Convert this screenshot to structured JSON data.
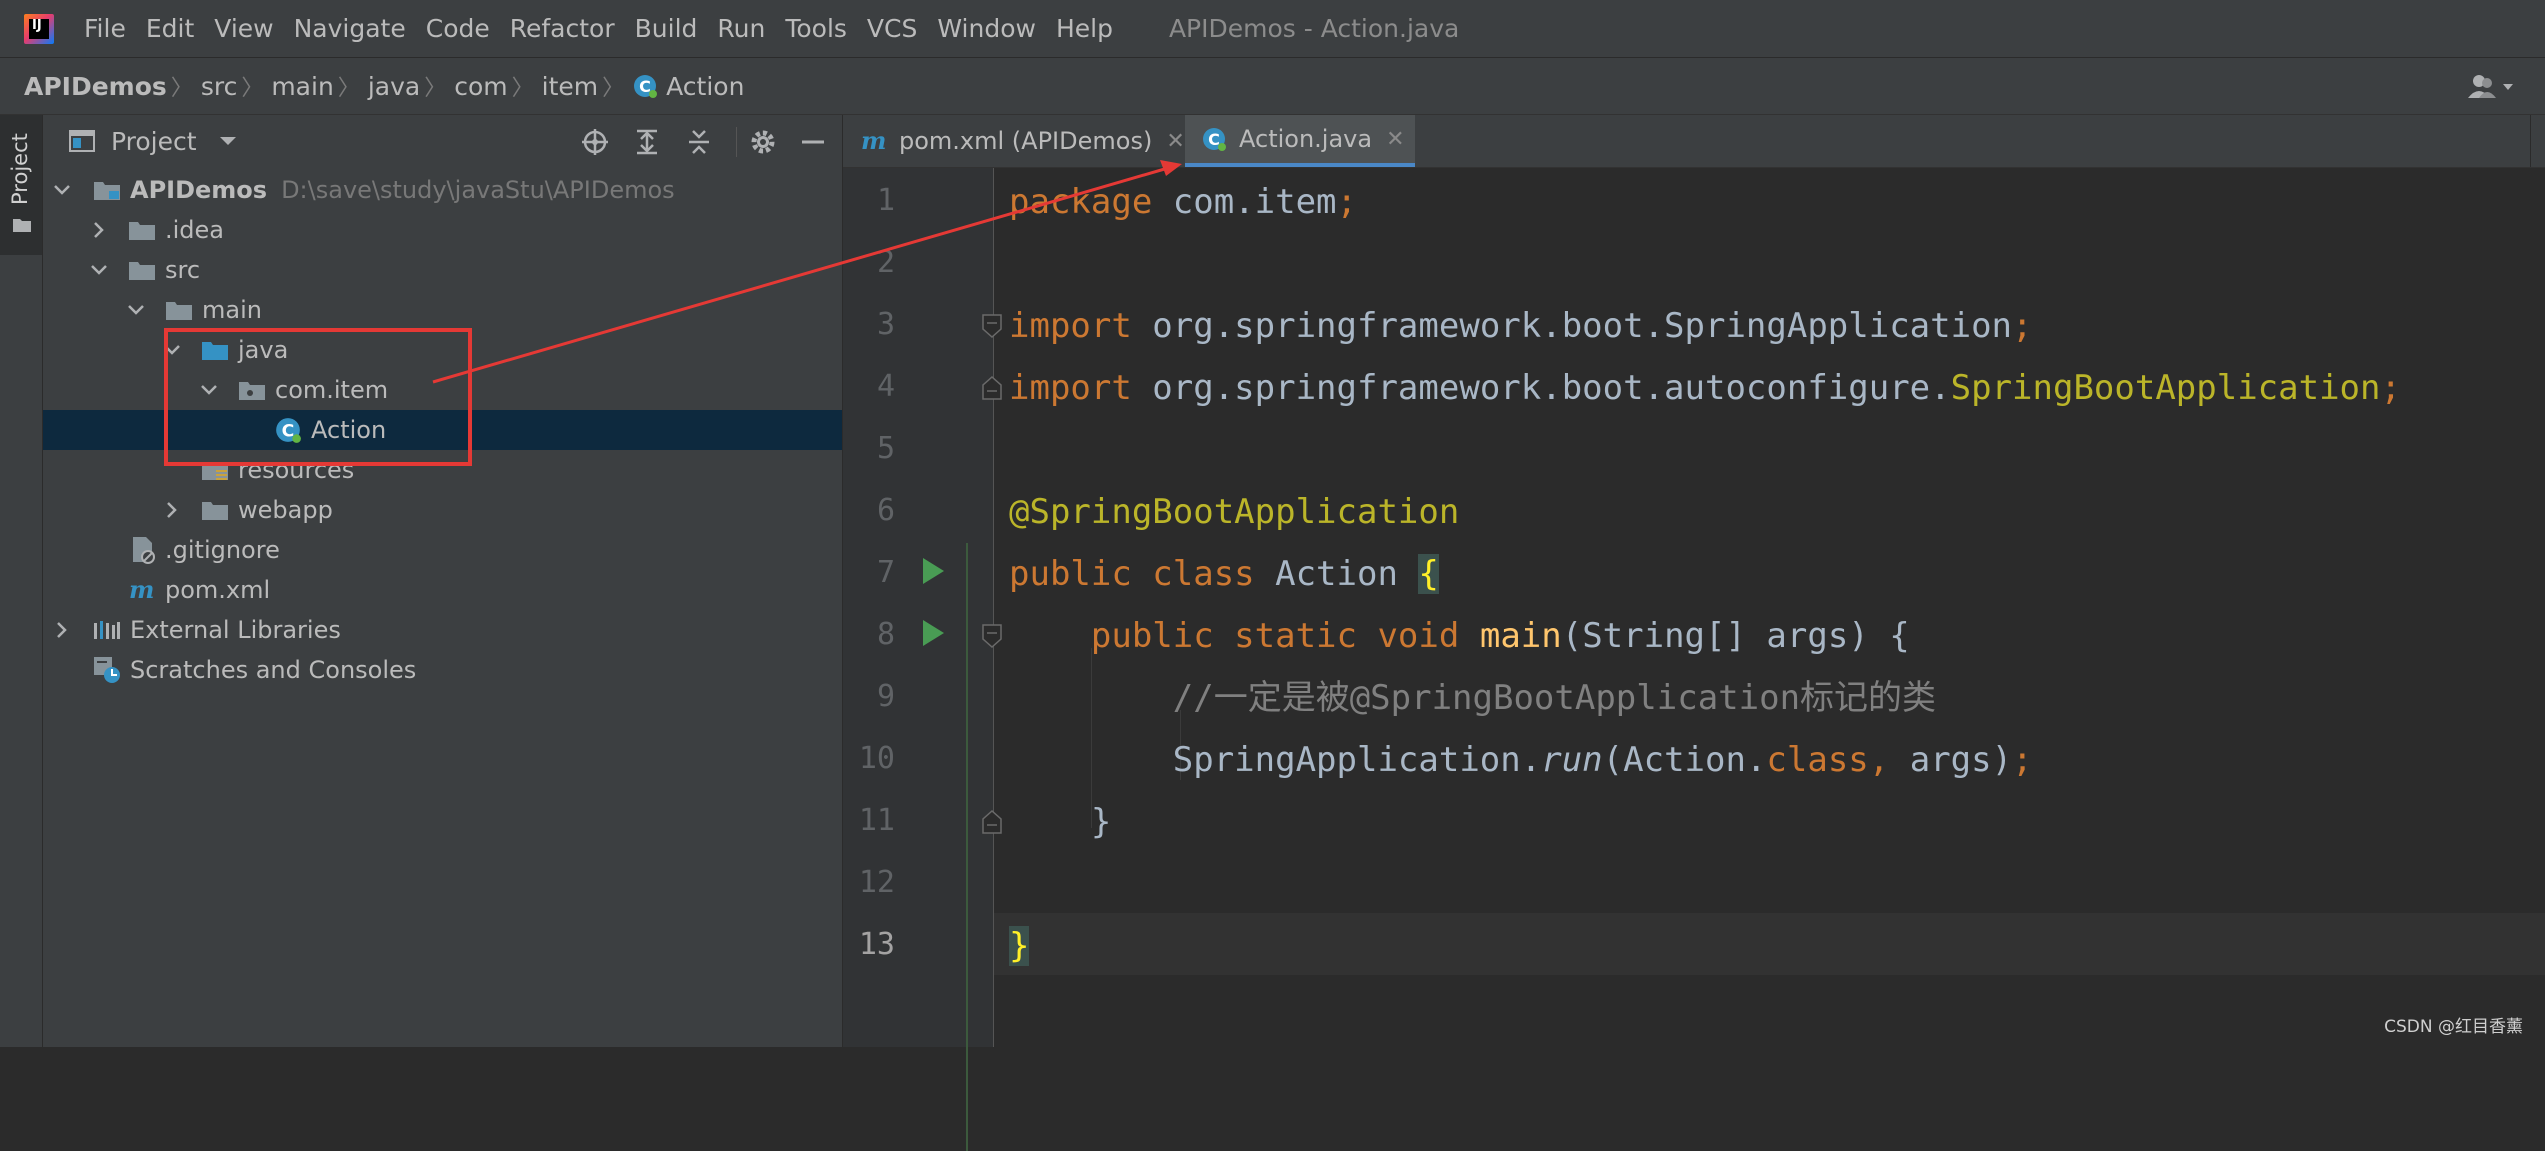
{
  "window": {
    "title": "APIDemos - Action.java",
    "logo_text": "IJ"
  },
  "menu": [
    "File",
    "Edit",
    "View",
    "Navigate",
    "Code",
    "Refactor",
    "Build",
    "Run",
    "Tools",
    "VCS",
    "Window",
    "Help"
  ],
  "breadcrumb": {
    "project": "APIDemos",
    "items": [
      "src",
      "main",
      "java",
      "com",
      "item"
    ],
    "file": "Action"
  },
  "tool_strip": {
    "project_label": "Project"
  },
  "project_panel": {
    "title": "Project",
    "tree": {
      "root_name": "APIDemos",
      "root_path": "D:\\save\\study\\javaStu\\APIDemos",
      "idea": ".idea",
      "src": "src",
      "main": "main",
      "java": "java",
      "package": "com.item",
      "action": "Action",
      "resources": "resources",
      "webapp": "webapp",
      "gitignore": ".gitignore",
      "pom": "pom.xml",
      "external_libraries": "External Libraries",
      "scratches": "Scratches and Consoles"
    }
  },
  "editor_tabs": [
    {
      "label": "pom.xml (APIDemos)",
      "active": false
    },
    {
      "label": "Action.java",
      "active": true
    }
  ],
  "editor": {
    "line_numbers": [
      "1",
      "2",
      "3",
      "4",
      "5",
      "6",
      "7",
      "8",
      "9",
      "10",
      "11",
      "12",
      "13"
    ],
    "current_line": 13,
    "code": {
      "l1_kw": "package",
      "l1_pkg": " com.item",
      "l1_semi": ";",
      "l3_kw": "import",
      "l3_path": " org.springframework.boot.SpringApplication",
      "l3_semi": ";",
      "l4_kw": "import",
      "l4_path": " org.springframework.boot.autoconfigure.",
      "l4_cls": "SpringBootApplication",
      "l4_semi": ";",
      "l6_ann": "@SpringBootApplication",
      "l7_kw": "public class",
      "l7_name": " Action ",
      "l7_brace": "{",
      "l8_indent": "    ",
      "l8_kw": "public static void",
      "l8_sp": " ",
      "l8_fn": "main",
      "l8_rest": "(String[] args) {",
      "l9_indent": "        ",
      "l9_cmt": "//一定是被@SpringBootApplication标记的类",
      "l10_indent": "        ",
      "l10_a": "SpringApplication.",
      "l10_run": "run",
      "l10_b": "(Action.",
      "l10_kw": "class, ",
      "l10_c": "args)",
      "l10_semi": ";",
      "l11_text": "    }",
      "l13_brace": "}"
    }
  },
  "watermark": "CSDN @红目香薰",
  "colors": {
    "background": "#2b2b2b",
    "keyword": "#cc7832",
    "annotation": "#bbb529",
    "comment": "#808080",
    "function": "#ffc66d",
    "selection": "#0d293e",
    "highlight_box": "#e53935"
  }
}
